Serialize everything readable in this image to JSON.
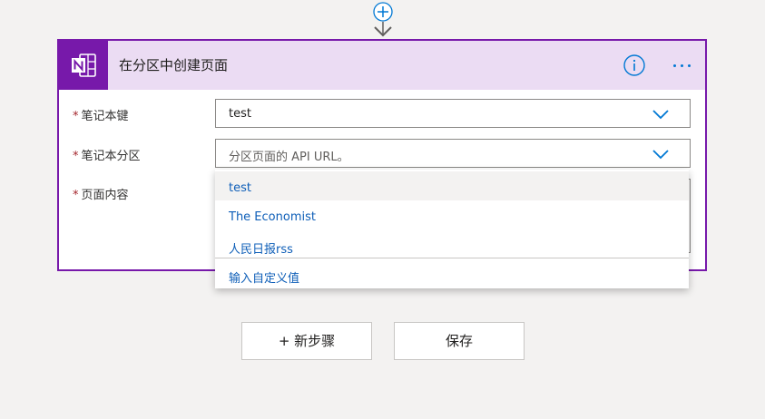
{
  "action_card": {
    "title": "在分区中创建页面",
    "app_icon": "onenote-icon",
    "header_color": "#ebdcf3",
    "accent_color": "#7719aa",
    "fields": [
      {
        "label": "笔记本键",
        "required_mark": "*",
        "value": "test"
      },
      {
        "label": "笔记本分区",
        "required_mark": "*",
        "placeholder": "分区页面的 API URL。"
      },
      {
        "label": "页面内容",
        "required_mark": "*"
      }
    ]
  },
  "dropdown": {
    "options": [
      "test",
      "The Economist",
      "人民日报rss"
    ],
    "highlighted_index": 0,
    "custom_value_label": "输入自定义值"
  },
  "buttons": {
    "new_step": "+ 新步骤",
    "save": "保存"
  }
}
